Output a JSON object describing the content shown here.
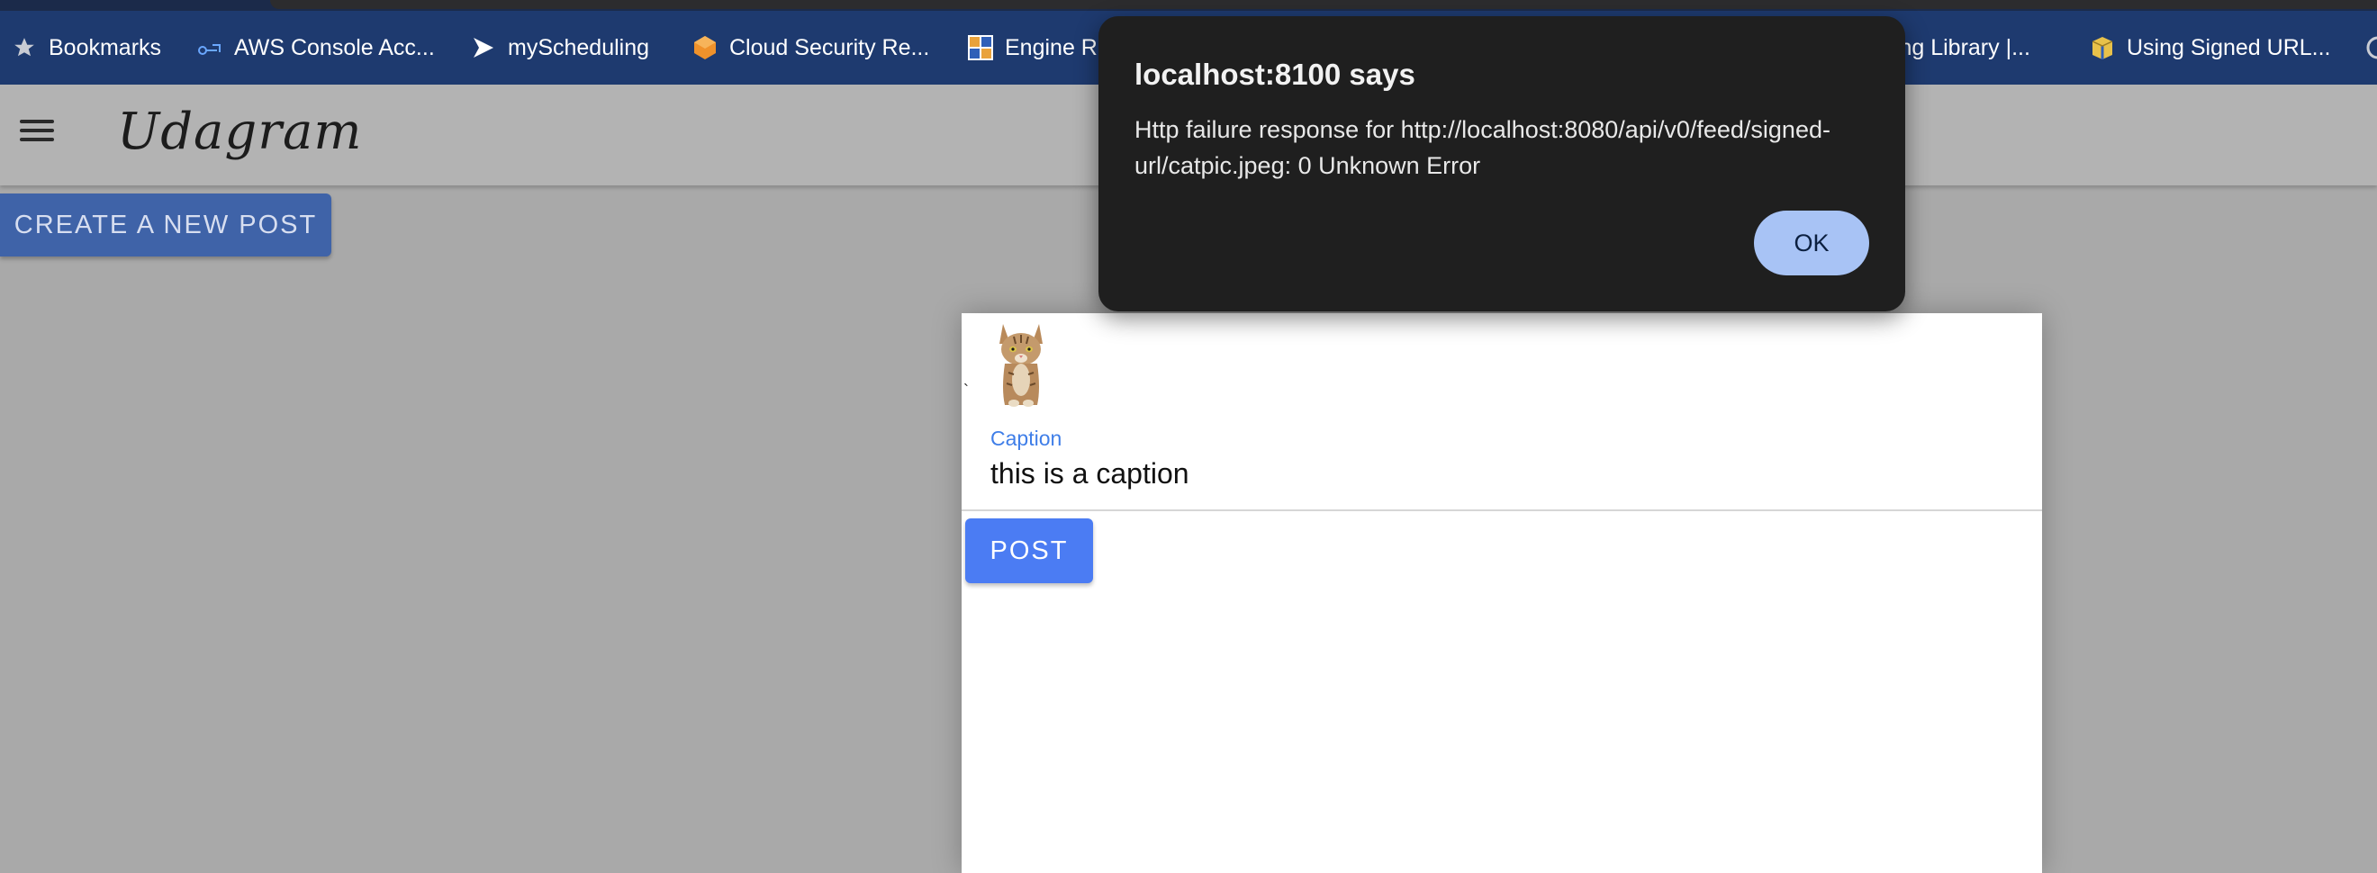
{
  "bookmarks_bar": {
    "items": [
      {
        "label": "Bookmarks",
        "icon": "star-icon"
      },
      {
        "label": "AWS Console Acc...",
        "icon": "aws-link-icon"
      },
      {
        "label": "myScheduling",
        "icon": "chevron-right-icon"
      },
      {
        "label": "Cloud Security Re...",
        "icon": "cube-icon"
      },
      {
        "label": "Engine R",
        "icon": "grid-logo-icon"
      },
      {
        "label": "ning Library |...",
        "icon": ""
      },
      {
        "label": "Using Signed URL...",
        "icon": "box-icon"
      }
    ]
  },
  "app": {
    "title": "Udagram",
    "create_button": "CREATE A NEW POST"
  },
  "post_form": {
    "caption_label": "Caption",
    "caption_value": "this is a caption",
    "post_button": "POST"
  },
  "alert": {
    "title": "localhost:8100 says",
    "message": "Http failure response for http://localhost:8080/api/v0/feed/signed-url/catpic.jpeg: 0 Unknown Error",
    "ok_button": "OK"
  },
  "colors": {
    "bookmarks_bg": "#1e3a6f",
    "primary": "#4b7cf3",
    "caption_label": "#3f7ee8",
    "alert_bg": "#1f1f1f",
    "alert_ok_bg": "#a8c3f5"
  }
}
